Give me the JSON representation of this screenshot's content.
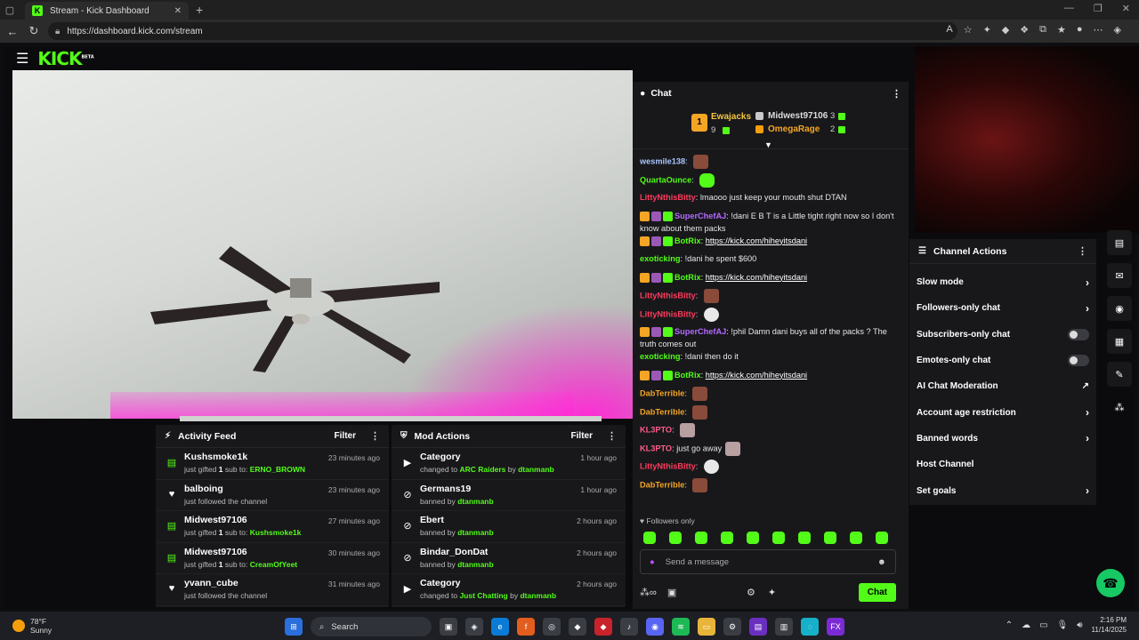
{
  "browser": {
    "tab_title": "Stream - Kick Dashboard",
    "url": "https://dashboard.kick.com/stream"
  },
  "header": {
    "logo": "KICK",
    "beta": "BETA"
  },
  "activity": {
    "title": "Activity Feed",
    "filter": "Filter",
    "items": [
      {
        "name": "Kushsmoke1k",
        "pre": "just gifted ",
        "count": "1",
        "mid": " sub to: ",
        "target": "ERNO_BROWN",
        "time": "23 minutes ago",
        "icon": "gift-icon"
      },
      {
        "name": "balboing",
        "pre": "just followed the channel",
        "count": "",
        "mid": "",
        "target": "",
        "time": "23 minutes ago",
        "icon": "heart-icon"
      },
      {
        "name": "Midwest97106",
        "pre": "just gifted ",
        "count": "1",
        "mid": " sub to: ",
        "target": "Kushsmoke1k",
        "time": "27 minutes ago",
        "icon": "gift-icon"
      },
      {
        "name": "Midwest97106",
        "pre": "just gifted ",
        "count": "1",
        "mid": " sub to: ",
        "target": "CreamOfYeet",
        "time": "30 minutes ago",
        "icon": "gift-icon"
      },
      {
        "name": "yvann_cube",
        "pre": "just followed the channel",
        "count": "",
        "mid": "",
        "target": "",
        "time": "31 minutes ago",
        "icon": "heart-icon"
      }
    ]
  },
  "mod": {
    "title": "Mod Actions",
    "filter": "Filter",
    "items": [
      {
        "name": "Category",
        "pre": "changed to ",
        "target": "ARC Raiders",
        "mid": " by ",
        "by": "dtanmanb",
        "time": "1 hour ago",
        "icon": "category-icon"
      },
      {
        "name": "Germans19",
        "pre": "banned by ",
        "target": "",
        "mid": "",
        "by": "dtanmanb",
        "time": "1 hour ago",
        "icon": "ban-icon"
      },
      {
        "name": "Ebert",
        "pre": "banned by ",
        "target": "",
        "mid": "",
        "by": "dtanmanb",
        "time": "2 hours ago",
        "icon": "ban-icon"
      },
      {
        "name": "Bindar_DonDat",
        "pre": "banned by ",
        "target": "",
        "mid": "",
        "by": "dtanmanb",
        "time": "2 hours ago",
        "icon": "ban-icon"
      },
      {
        "name": "Category",
        "pre": "changed to ",
        "target": "Just Chatting",
        "mid": " by ",
        "by": "dtanmanb",
        "time": "2 hours ago",
        "icon": "category-icon"
      }
    ]
  },
  "chat": {
    "title": "Chat",
    "leaders": {
      "first": {
        "rank": "1",
        "name": "Ewajacks",
        "count": "9"
      },
      "second": {
        "name": "Midwest97106",
        "count": "3"
      },
      "third": {
        "name": "OmegaRage",
        "count": "2"
      }
    },
    "messages": [
      {
        "user": "wesmile138",
        "color": "#a9c7ff",
        "text": "",
        "emote": "brown",
        "link": ""
      },
      {
        "user": "QuartaOunce",
        "color": "#53fc18",
        "text": "",
        "emote": "green",
        "link": ""
      },
      {
        "user": "LittyNthisBitty",
        "color": "#ff3b5c",
        "text": "lmaooo just keep your mouth shut DTAN",
        "emote": "",
        "link": ""
      },
      {
        "user": "SuperChefAJ",
        "color": "#b36bff",
        "text": "!dani E B T is a Little tight right now so I don't know about them packs",
        "emote": "",
        "link": "",
        "badges": true
      },
      {
        "user": "BotRix",
        "color": "#53fc18",
        "text": "",
        "emote": "",
        "link": "https://kick.com/hiheyitsdani",
        "badges": true
      },
      {
        "user": "exoticking",
        "color": "#53fc18",
        "text": "!dani he spent $600",
        "emote": "",
        "link": ""
      },
      {
        "user": "BotRix",
        "color": "#53fc18",
        "text": "",
        "emote": "",
        "link": "https://kick.com/hiheyitsdani",
        "badges": true
      },
      {
        "user": "LittyNthisBitty",
        "color": "#ff3b5c",
        "text": "",
        "emote": "brown",
        "link": ""
      },
      {
        "user": "LittyNthisBitty",
        "color": "#ff3b5c",
        "text": "",
        "emote": "white",
        "link": ""
      },
      {
        "user": "SuperChefAJ",
        "color": "#b36bff",
        "text": "!phil Damn dani buys all of the packs ? The truth comes out",
        "emote": "",
        "link": "",
        "badges": true
      },
      {
        "user": "exoticking",
        "color": "#53fc18",
        "text": "!dani then do it",
        "emote": "",
        "link": ""
      },
      {
        "user": "BotRix",
        "color": "#53fc18",
        "text": "",
        "emote": "",
        "link": "https://kick.com/hiheyitsdani",
        "badges": true
      },
      {
        "user": "DabTerrible",
        "color": "#f5a524",
        "text": "",
        "emote": "brown",
        "link": ""
      },
      {
        "user": "DabTerrible",
        "color": "#f5a524",
        "text": "",
        "emote": "brown",
        "link": ""
      },
      {
        "user": "KL3PTO",
        "color": "#ff5c8a",
        "text": "",
        "emote": "cat",
        "link": ""
      },
      {
        "user": "KL3PTO",
        "color": "#ff5c8a",
        "text": "just go away",
        "emote": "cat",
        "link": ""
      },
      {
        "user": "LittyNthisBitty",
        "color": "#ff3b5c",
        "text": "",
        "emote": "white",
        "link": ""
      },
      {
        "user": "DabTerrible",
        "color": "#f5a524",
        "text": "",
        "emote": "brown",
        "link": ""
      }
    ],
    "followers_only": "Followers only",
    "placeholder": "Send a message",
    "send": "Chat"
  },
  "channel_actions": {
    "title": "Channel Actions",
    "items": [
      {
        "label": "Slow mode",
        "ctl": "chevron"
      },
      {
        "label": "Followers-only chat",
        "ctl": "chevron"
      },
      {
        "label": "Subscribers-only chat",
        "ctl": "toggle"
      },
      {
        "label": "Emotes-only chat",
        "ctl": "toggle"
      },
      {
        "label": "AI Chat Moderation",
        "ctl": "external"
      },
      {
        "label": "Account age restriction",
        "ctl": "chevron"
      },
      {
        "label": "Banned words",
        "ctl": "chevron"
      },
      {
        "label": "Host Channel",
        "ctl": "none"
      },
      {
        "label": "Set goals",
        "ctl": "chevron"
      }
    ]
  },
  "taskbar": {
    "temp": "78°F",
    "cond": "Sunny",
    "search": "Search",
    "time": "2:16 PM",
    "date": "11/14/2025"
  },
  "colors": {
    "accent": "#53fc18",
    "bg": "#0b0b0d",
    "panel": "#18181b"
  }
}
